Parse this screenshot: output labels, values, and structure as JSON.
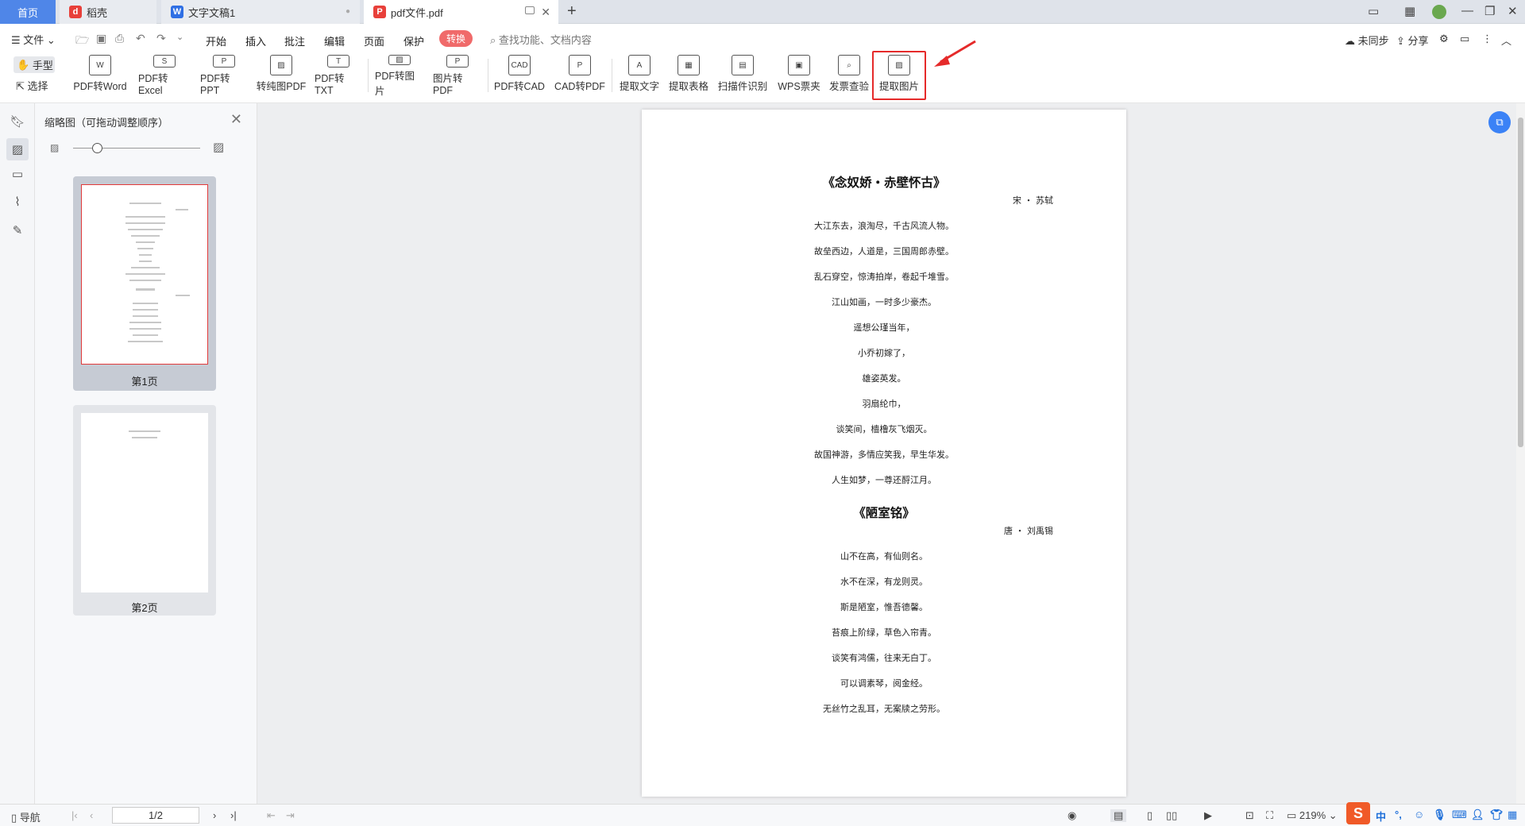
{
  "tabs": [
    {
      "label": "首页"
    },
    {
      "label": "稻壳"
    },
    {
      "label": "文字文稿1"
    },
    {
      "label": "pdf文件.pdf"
    }
  ],
  "menu": {
    "file": "文件",
    "items": [
      "开始",
      "插入",
      "批注",
      "编辑",
      "页面",
      "保护"
    ],
    "active": "转换",
    "search_placeholder": "查找功能、文档内容",
    "sync": "未同步",
    "share": "分享"
  },
  "tools": {
    "hand": "手型",
    "select": "选择"
  },
  "ribbon": [
    {
      "label": "PDF转Word",
      "icon": "pdf-to-word-icon"
    },
    {
      "label": "PDF转Excel",
      "icon": "pdf-to-excel-icon"
    },
    {
      "label": "PDF转PPT",
      "icon": "pdf-to-ppt-icon"
    },
    {
      "label": "转纯图PDF",
      "icon": "to-image-pdf-icon"
    },
    {
      "label": "PDF转TXT",
      "icon": "pdf-to-txt-icon"
    },
    {
      "label": "PDF转图片",
      "icon": "pdf-to-image-icon"
    },
    {
      "label": "图片转PDF",
      "icon": "image-to-pdf-icon"
    },
    {
      "label": "PDF转CAD",
      "icon": "pdf-to-cad-icon"
    },
    {
      "label": "CAD转PDF",
      "icon": "cad-to-pdf-icon"
    },
    {
      "label": "提取文字",
      "icon": "extract-text-icon"
    },
    {
      "label": "提取表格",
      "icon": "extract-table-icon"
    },
    {
      "label": "扫描件识别",
      "icon": "scan-recognize-icon"
    },
    {
      "label": "WPS票夹",
      "icon": "ticket-folder-icon"
    },
    {
      "label": "发票查验",
      "icon": "invoice-check-icon"
    },
    {
      "label": "提取图片",
      "icon": "extract-image-icon"
    }
  ],
  "thumbnails": {
    "title": "缩略图（可拖动调整顺序）",
    "pages": [
      {
        "label": "第1页"
      },
      {
        "label": "第2页"
      }
    ]
  },
  "document": {
    "poem1": {
      "title": "《念奴娇・赤壁怀古》",
      "author": "宋 ・ 苏轼",
      "lines": [
        "大江东去，浪淘尽，千古风流人物。",
        "故垒西边，人道是，三国周郎赤壁。",
        "乱石穿空，惊涛拍岸，卷起千堆雪。",
        "江山如画，一时多少豪杰。",
        "遥想公瑾当年，",
        "小乔初嫁了，",
        "雄姿英发。",
        "羽扇纶巾，",
        "谈笑间，樯橹灰飞烟灭。",
        "故国神游，多情应笑我，早生华发。",
        "人生如梦，一尊还酹江月。"
      ]
    },
    "poem2": {
      "title": "《陋室铭》",
      "author": "唐 ・ 刘禹锡",
      "lines": [
        "山不在高，有仙则名。",
        "水不在深，有龙则灵。",
        "斯是陋室，惟吾德馨。",
        "苔痕上阶绿，草色入帘青。",
        "谈笑有鸿儒，往来无白丁。",
        "可以调素琴，阅金经。",
        "无丝竹之乱耳，无案牍之劳形。"
      ]
    }
  },
  "status": {
    "nav": "导航",
    "page": "1/2",
    "zoom": "219%"
  },
  "ime": {
    "logo": "S",
    "lang": "中"
  },
  "colors": {
    "accent": "#4f86e8",
    "active_menu": "#f06a6a",
    "highlight": "#e52a2a"
  }
}
